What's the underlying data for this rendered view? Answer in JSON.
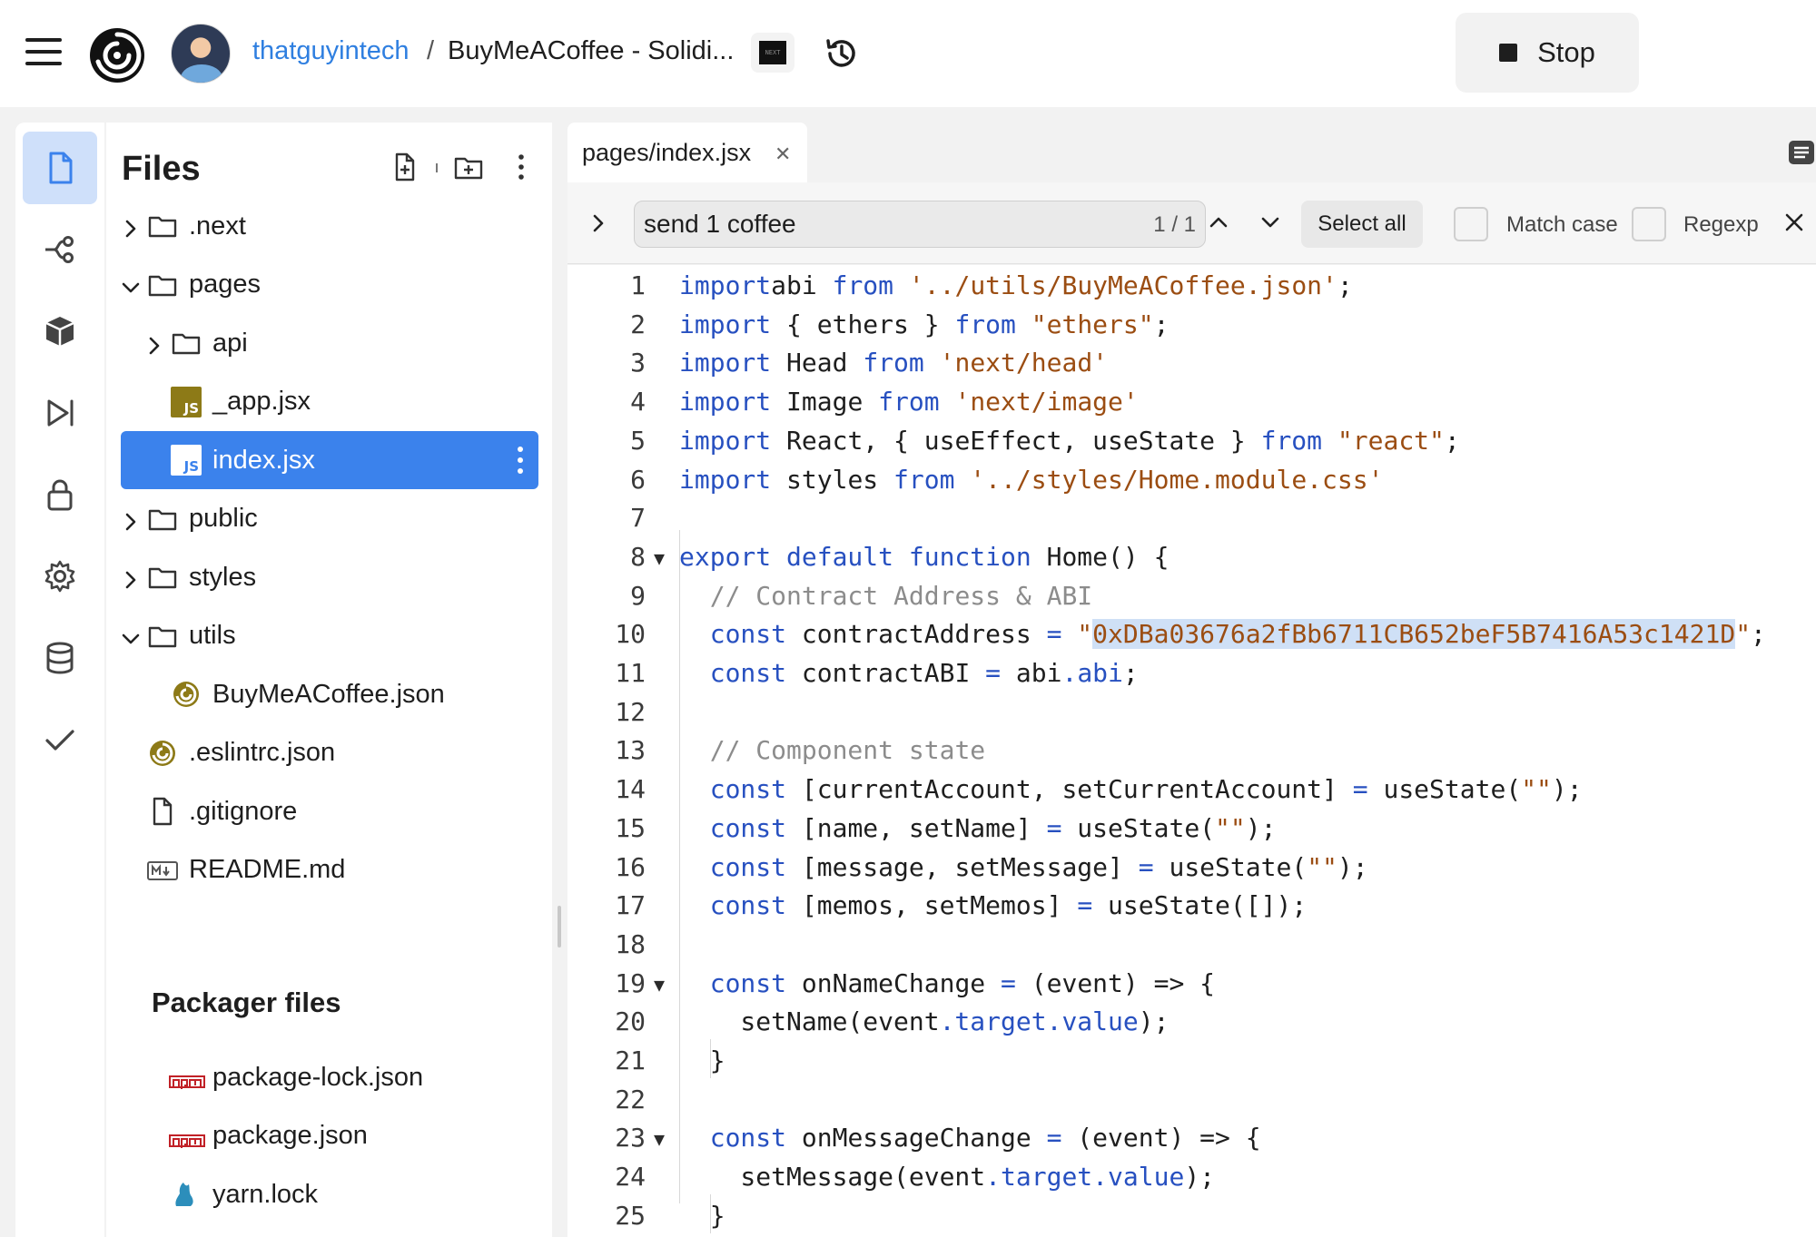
{
  "topbar": {
    "user": "thatguyintech",
    "separator": "/",
    "repo": "BuyMeACoffee - Solidi...",
    "stop_label": "Stop"
  },
  "sidebar": {
    "title": "Files",
    "tree": [
      {
        "label": ".next",
        "type": "folder",
        "expanded": false,
        "depth": 0
      },
      {
        "label": "pages",
        "type": "folder",
        "expanded": true,
        "depth": 0
      },
      {
        "label": "api",
        "type": "folder",
        "expanded": false,
        "depth": 1
      },
      {
        "label": "_app.jsx",
        "type": "js-file",
        "depth": 1
      },
      {
        "label": "index.jsx",
        "type": "js-file",
        "depth": 1,
        "selected": true
      },
      {
        "label": "public",
        "type": "folder",
        "expanded": false,
        "depth": 0
      },
      {
        "label": "styles",
        "type": "folder",
        "expanded": false,
        "depth": 0
      },
      {
        "label": "utils",
        "type": "folder",
        "expanded": true,
        "depth": 0
      },
      {
        "label": "BuyMeACoffee.json",
        "type": "json-file",
        "depth": 1
      },
      {
        "label": ".eslintrc.json",
        "type": "json-file",
        "depth": 0
      },
      {
        "label": ".gitignore",
        "type": "file",
        "depth": 0
      },
      {
        "label": "README.md",
        "type": "markdown-file",
        "depth": 0
      }
    ],
    "packager_title": "Packager files",
    "packager_files": [
      {
        "label": "package-lock.json",
        "type": "npm-file"
      },
      {
        "label": "package.json",
        "type": "npm-file"
      },
      {
        "label": "yarn.lock",
        "type": "yarn-file"
      }
    ]
  },
  "editor": {
    "tab_label": "pages/index.jsx",
    "find": {
      "query": "send 1 coffee",
      "count": "1 / 1",
      "select_all_label": "Select all",
      "match_case_label": "Match case",
      "regexp_label": "Regexp"
    },
    "line_numbers": [
      "1",
      "2",
      "3",
      "4",
      "5",
      "6",
      "7",
      "8",
      "9",
      "10",
      "11",
      "12",
      "13",
      "14",
      "15",
      "16",
      "17",
      "18",
      "19",
      "20",
      "21",
      "22",
      "23",
      "24",
      "25"
    ],
    "fold_markers": [
      "8",
      "19",
      "23"
    ],
    "lines": [
      [
        [
          "kw",
          "import"
        ],
        [
          "",
          "abi "
        ],
        [
          "kw",
          "from"
        ],
        [
          "",
          ""
        ],
        [
          "str",
          " '../utils/BuyMeACoffee.json'"
        ],
        [
          "",
          ";"
        ]
      ],
      [
        [
          "kw",
          "import"
        ],
        [
          "",
          " { ethers } "
        ],
        [
          "kw",
          "from"
        ],
        [
          "str",
          " \"ethers\""
        ],
        [
          "",
          ";"
        ]
      ],
      [
        [
          "kw",
          "import"
        ],
        [
          "",
          " Head "
        ],
        [
          "kw",
          "from"
        ],
        [
          "str",
          " 'next/head'"
        ]
      ],
      [
        [
          "kw",
          "import"
        ],
        [
          "",
          " Image "
        ],
        [
          "kw",
          "from"
        ],
        [
          "str",
          " 'next/image'"
        ]
      ],
      [
        [
          "kw",
          "import"
        ],
        [
          "",
          " React, { useEffect, useState } "
        ],
        [
          "kw",
          "from"
        ],
        [
          "str",
          " \"react\""
        ],
        [
          "",
          ";"
        ]
      ],
      [
        [
          "kw",
          "import"
        ],
        [
          "",
          " styles "
        ],
        [
          "kw",
          "from"
        ],
        [
          "str",
          " '../styles/Home.module.css'"
        ]
      ],
      [],
      [
        [
          "kw",
          "export default function"
        ],
        [
          "",
          " Home() {"
        ]
      ],
      [
        [
          "",
          "  "
        ],
        [
          "cm",
          "// Contract Address & ABI"
        ]
      ],
      [
        [
          "",
          "  "
        ],
        [
          "kw",
          "const"
        ],
        [
          "",
          " contractAddress "
        ],
        [
          "op",
          "="
        ],
        [
          "str",
          " \""
        ],
        [
          "hlstr",
          "0xDBa03676a2fBb6711CB652beF5B7416A53c1421D"
        ],
        [
          "str",
          "\""
        ],
        [
          "",
          ";"
        ]
      ],
      [
        [
          "",
          "  "
        ],
        [
          "kw",
          "const"
        ],
        [
          "",
          " contractABI "
        ],
        [
          "op",
          "="
        ],
        [
          "",
          " abi"
        ],
        [
          "kw",
          ".abi"
        ],
        [
          "",
          ";"
        ]
      ],
      [],
      [
        [
          "",
          "  "
        ],
        [
          "cm",
          "// Component state"
        ]
      ],
      [
        [
          "",
          "  "
        ],
        [
          "kw",
          "const"
        ],
        [
          "",
          " [currentAccount, setCurrentAccount] "
        ],
        [
          "op",
          "="
        ],
        [
          "",
          " useState("
        ],
        [
          "str",
          "\"\""
        ],
        [
          "",
          ");"
        ]
      ],
      [
        [
          "",
          "  "
        ],
        [
          "kw",
          "const"
        ],
        [
          "",
          " [name, setName] "
        ],
        [
          "op",
          "="
        ],
        [
          "",
          " useState("
        ],
        [
          "str",
          "\"\""
        ],
        [
          "",
          ");"
        ]
      ],
      [
        [
          "",
          "  "
        ],
        [
          "kw",
          "const"
        ],
        [
          "",
          " [message, setMessage] "
        ],
        [
          "op",
          "="
        ],
        [
          "",
          " useState("
        ],
        [
          "str",
          "\"\""
        ],
        [
          "",
          ");"
        ]
      ],
      [
        [
          "",
          "  "
        ],
        [
          "kw",
          "const"
        ],
        [
          "",
          " [memos, setMemos] "
        ],
        [
          "op",
          "="
        ],
        [
          "",
          " useState([]);"
        ]
      ],
      [],
      [
        [
          "",
          "  "
        ],
        [
          "kw",
          "const"
        ],
        [
          "",
          " onNameChange "
        ],
        [
          "op",
          "="
        ],
        [
          "",
          " (event) => {"
        ]
      ],
      [
        [
          "",
          "    setName(event"
        ],
        [
          "kw",
          ".target.value"
        ],
        [
          "",
          ");"
        ]
      ],
      [
        [
          "",
          "  }"
        ]
      ],
      [],
      [
        [
          "",
          "  "
        ],
        [
          "kw",
          "const"
        ],
        [
          "",
          " onMessageChange "
        ],
        [
          "op",
          "="
        ],
        [
          "",
          " (event) => {"
        ]
      ],
      [
        [
          "",
          "    setMessage(event"
        ],
        [
          "kw",
          ".target.value"
        ],
        [
          "",
          ");"
        ]
      ],
      [
        [
          "",
          "  }"
        ]
      ]
    ]
  },
  "colors": {
    "accent": "#3b82ec",
    "link": "#2f7fe0",
    "keyword": "#2750c0",
    "string": "#9b4d12",
    "comment": "#8c8c8c",
    "search_highlight": "#cfe0f6"
  }
}
